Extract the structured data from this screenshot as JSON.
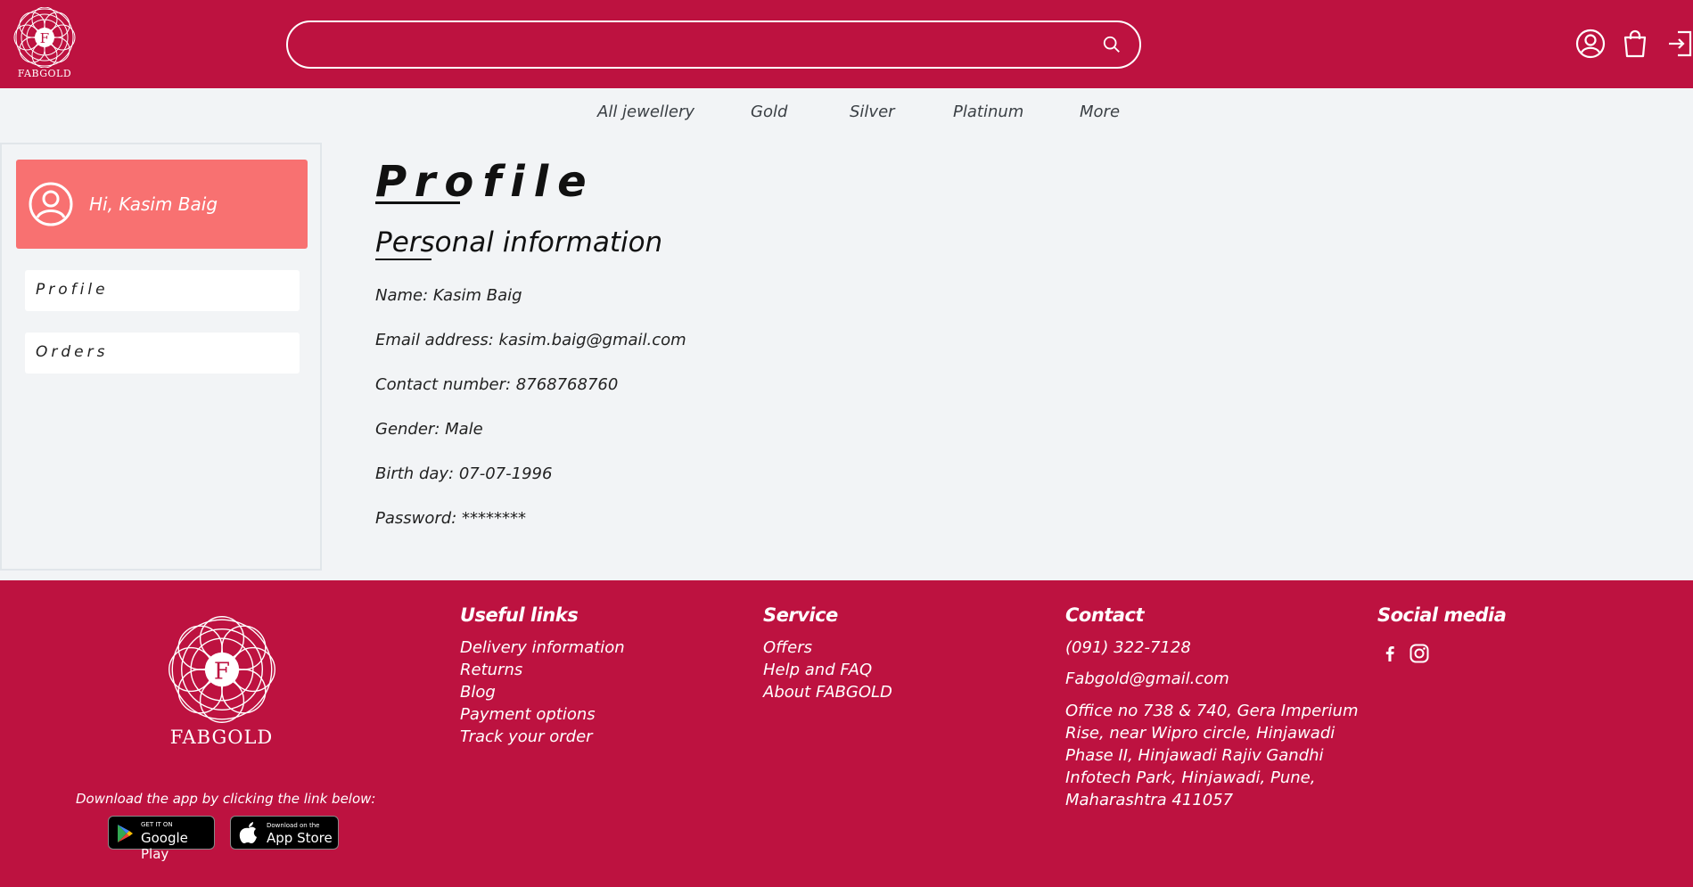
{
  "brand": {
    "name": "FABGOLD",
    "letter": "F"
  },
  "search": {
    "placeholder": ""
  },
  "nav": [
    "All jewellery",
    "Gold",
    "Silver",
    "Platinum",
    "More"
  ],
  "sidebar": {
    "greeting": "Hi, Kasim Baig",
    "items": [
      "Profile",
      "Orders"
    ]
  },
  "main": {
    "title": "Profile",
    "section": "Personal information",
    "fields": [
      "Name: Kasim Baig",
      "Email address: kasim.baig@gmail.com",
      "Contact number: 8768768760",
      "Gender: Male",
      "Birth day: 07-07-1996",
      "Password: ********"
    ]
  },
  "footer": {
    "download_text": "Download the app by clicking the link below:",
    "google_play": {
      "small": "GET IT ON",
      "big": "Google Play"
    },
    "app_store": {
      "small": "Download on the",
      "big": "App Store"
    },
    "useful_links": {
      "heading": "Useful links",
      "items": [
        "Delivery information",
        "Returns",
        "Blog",
        "Payment options",
        "Track your order"
      ]
    },
    "service": {
      "heading": "Service",
      "items": [
        "Offers",
        "Help and FAQ",
        "About FABGOLD"
      ]
    },
    "contact": {
      "heading": "Contact",
      "phone": "(091) 322-7128",
      "email": "Fabgold@gmail.com",
      "address": "Office no 738 & 740, Gera Imperium Rise, near Wipro circle, Hinjawadi Phase II, Hinjawadi Rajiv Gandhi Infotech Park, Hinjawadi, Pune, Maharashtra 411057"
    },
    "social": {
      "heading": "Social media"
    }
  },
  "colors": {
    "brand": "#bd1240",
    "greeting_bg": "#f87171",
    "page_bg": "#f2f4f6"
  }
}
